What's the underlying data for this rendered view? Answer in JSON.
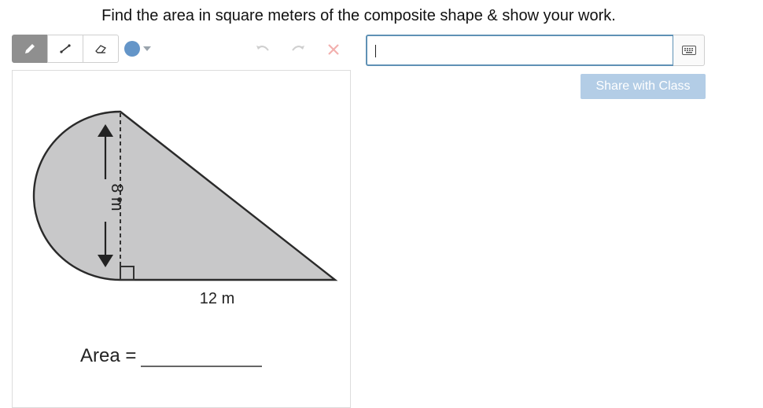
{
  "prompt": "Find the area in square meters of the composite shape & show your work.",
  "toolbar": {
    "tools": [
      {
        "name": "pencil-tool",
        "icon": "pencil-icon",
        "active": true
      },
      {
        "name": "line-tool",
        "icon": "line-icon",
        "active": false
      },
      {
        "name": "eraser-tool",
        "icon": "eraser-icon",
        "active": false
      }
    ],
    "color": "#6495c8",
    "undo_icon": "undo-icon",
    "redo_icon": "redo-icon",
    "clear_icon": "close-icon"
  },
  "figure": {
    "height_label": "8 m",
    "base_label": "12 m",
    "area_label": "Area ="
  },
  "answer": {
    "value": "",
    "keyboard_icon": "keyboard-icon"
  },
  "share_button": "Share with Class",
  "colors": {
    "input_border": "#5f91b5",
    "share_button_bg": "#b3cde6",
    "shape_fill": "#c8c8c9",
    "clear_icon": "#f2b0ae"
  }
}
